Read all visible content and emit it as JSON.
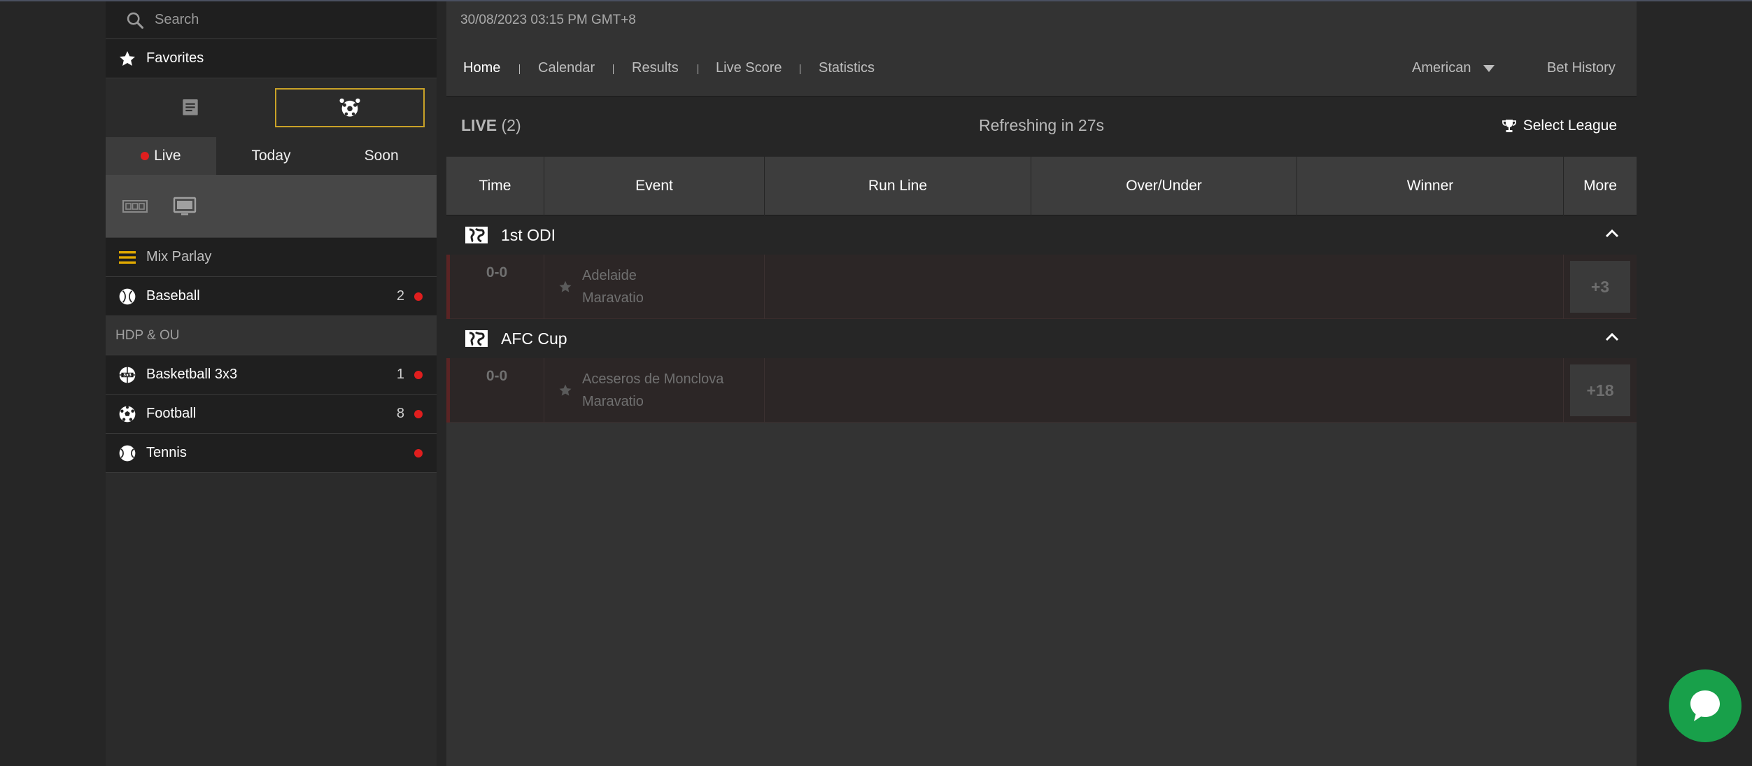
{
  "sidebar": {
    "search_placeholder": "Search",
    "favorites_label": "Favorites",
    "time_tabs": [
      {
        "label": "Live",
        "active": true
      },
      {
        "label": "Today",
        "active": false
      },
      {
        "label": "Soon",
        "active": false
      }
    ],
    "mix_parlay_label": "Mix Parlay",
    "baseball": {
      "label": "Baseball",
      "count": "2"
    },
    "hdp_ou_label": "HDP & OU",
    "basketball": {
      "label": "Basketball 3x3",
      "count": "1"
    },
    "football": {
      "label": "Football",
      "count": "8"
    },
    "tennis": {
      "label": "Tennis",
      "count": ""
    }
  },
  "header": {
    "datetime": "30/08/2023 03:15 PM GMT+8",
    "nav": {
      "home": "Home",
      "calendar": "Calendar",
      "results": "Results",
      "live_score": "Live Score",
      "statistics": "Statistics"
    },
    "odds_format": "American",
    "bet_history": "Bet History"
  },
  "live": {
    "title": "LIVE",
    "count": "(2)",
    "refresh": "Refreshing in 27s",
    "select_league": "Select League"
  },
  "columns": {
    "time": "Time",
    "event": "Event",
    "run_line": "Run Line",
    "over_under": "Over/Under",
    "winner": "Winner",
    "more": "More"
  },
  "leagues": [
    {
      "name": "1st ODI",
      "match": {
        "score": "0-0",
        "home": "Adelaide",
        "away": "Maravatio",
        "more": "+3"
      }
    },
    {
      "name": "AFC Cup",
      "match": {
        "score": "0-0",
        "home": "Aceseros de Monclova",
        "away": "Maravatio",
        "more": "+18"
      }
    }
  ],
  "colors": {
    "accent": "#c9a227",
    "live_dot": "#e01e1e",
    "chat": "#18a04a"
  }
}
